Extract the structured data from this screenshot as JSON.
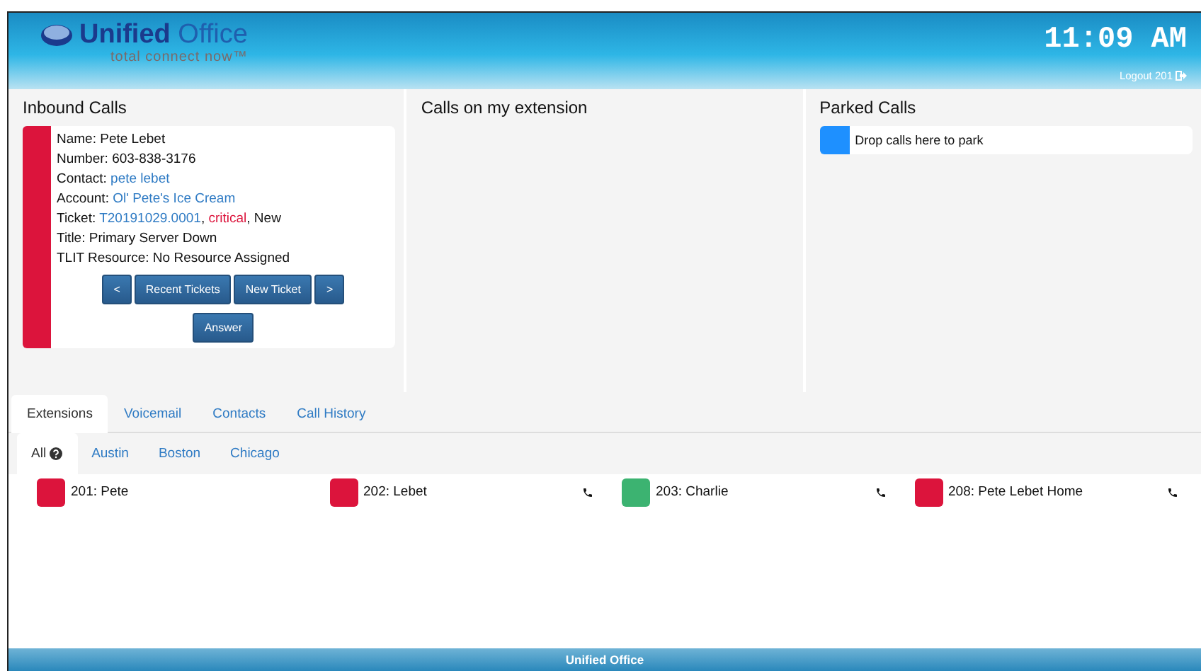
{
  "header": {
    "logo_title": {
      "first": "Unified",
      "second": "Office"
    },
    "logo_tagline": "total connect now™",
    "clock": "11:09 AM",
    "logout": "Logout 201"
  },
  "panels": [
    {
      "title": "Inbound Calls",
      "kind": "inbound"
    },
    {
      "title": "Calls on my extension",
      "kind": "empty"
    },
    {
      "title": "Parked Calls",
      "kind": "parked"
    }
  ],
  "inbound_call": {
    "color": "#dc143c",
    "fields": [
      {
        "parts": [
          {
            "text": "Name: ",
            "kind": "plain"
          },
          {
            "text": "Pete Lebet",
            "kind": "plain"
          }
        ]
      },
      {
        "parts": [
          {
            "text": "Number: ",
            "kind": "plain"
          },
          {
            "text": "603-838-3176",
            "kind": "plain"
          }
        ]
      },
      {
        "parts": [
          {
            "text": "Contact: ",
            "kind": "plain"
          },
          {
            "text": "pete lebet",
            "kind": "link"
          }
        ]
      },
      {
        "parts": [
          {
            "text": "Account: ",
            "kind": "plain"
          },
          {
            "text": "Ol' Pete's Ice Cream",
            "kind": "link"
          }
        ]
      },
      {
        "parts": [
          {
            "text": "Ticket: ",
            "kind": "plain"
          },
          {
            "text": "T20191029.0001",
            "kind": "link"
          },
          {
            "text": ", ",
            "kind": "plain"
          },
          {
            "text": "critical",
            "kind": "alert"
          },
          {
            "text": ", New",
            "kind": "plain"
          }
        ]
      },
      {
        "parts": [
          {
            "text": "Title: Primary Server Down",
            "kind": "plain"
          }
        ]
      },
      {
        "parts": [
          {
            "text": "TLIT Resource: No Resource Assigned",
            "kind": "plain"
          }
        ]
      }
    ],
    "buttons": [
      "<",
      "Recent Tickets",
      "New Ticket",
      ">"
    ],
    "answer": "Answer"
  },
  "parked": {
    "color": "#1e90ff",
    "text": "Drop calls here to park"
  },
  "tabs": [
    {
      "label": "Extensions",
      "selected": true
    },
    {
      "label": "Voicemail",
      "selected": false
    },
    {
      "label": "Contacts",
      "selected": false
    },
    {
      "label": "Call History",
      "selected": false
    }
  ],
  "subtabs": [
    {
      "label": "All",
      "selected": true,
      "help": true
    },
    {
      "label": "Austin",
      "selected": false,
      "help": false
    },
    {
      "label": "Boston",
      "selected": false,
      "help": false
    },
    {
      "label": "Chicago",
      "selected": false,
      "help": false
    }
  ],
  "extensions": [
    {
      "label": "201: Pete",
      "color": "#dc143c",
      "phone": false
    },
    {
      "label": "202: Lebet",
      "color": "#dc143c",
      "phone": true
    },
    {
      "label": "203: Charlie",
      "color": "#3cb371",
      "phone": true
    },
    {
      "label": "208: Pete Lebet Home",
      "color": "#dc143c",
      "phone": true
    }
  ],
  "footer": "Unified Office"
}
